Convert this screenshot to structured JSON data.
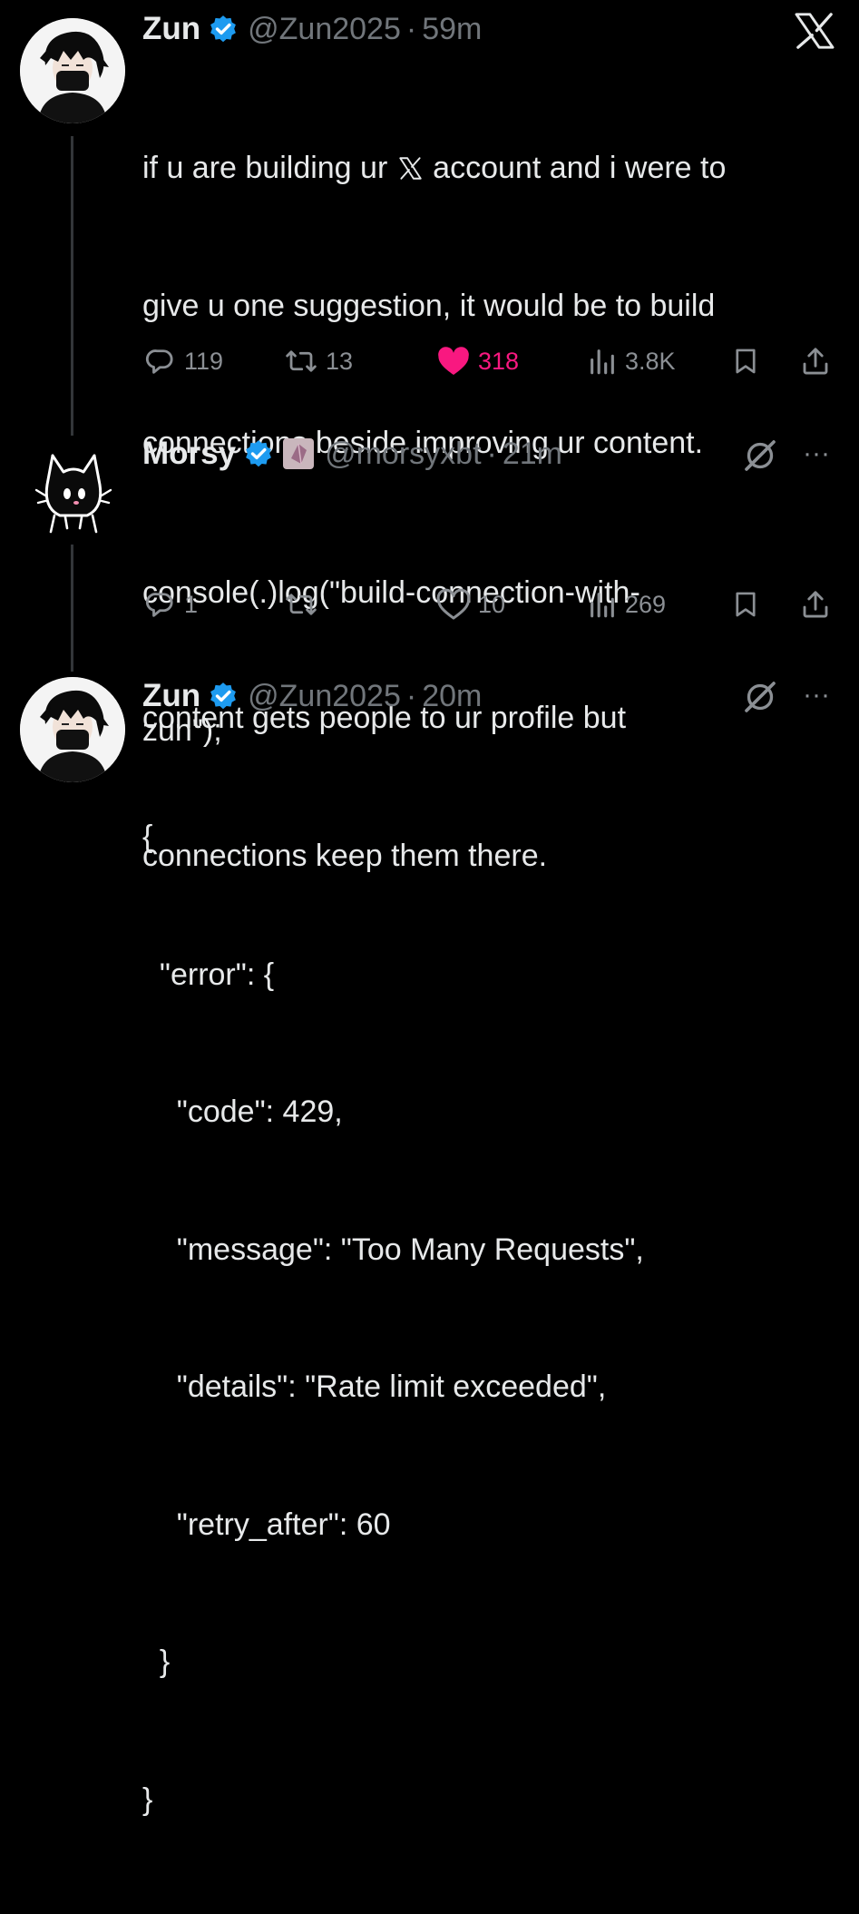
{
  "colors": {
    "background": "#000000",
    "text": "#e7e9ea",
    "muted": "#71767b",
    "like": "#f91880",
    "verified": "#1d9bf0"
  },
  "app_logo": "x-logo-icon",
  "tweets": [
    {
      "name": "Zun",
      "handle": "@Zun2025",
      "separator": "·",
      "time": "59m",
      "text_lines": [
        "if u are building ur ",
        " account and i were to",
        "give u one suggestion, it would be to build",
        "connections beside improving ur content.",
        "",
        "content gets people to ur profile but",
        "connections keep them there."
      ],
      "stats": {
        "replies": "119",
        "reposts": "13",
        "likes": "318",
        "views": "3.8K"
      },
      "liked": true
    },
    {
      "name": "Morsy",
      "handle": "@morsyxbt",
      "separator": "·",
      "time": "21m",
      "text_lines": [
        "console(.)log(\"build-connection-with-",
        "zun\");"
      ],
      "stats": {
        "replies": "1",
        "reposts": "",
        "likes": "10",
        "views": "269"
      },
      "liked": false
    },
    {
      "name": "Zun",
      "handle": "@Zun2025",
      "separator": "·",
      "time": "20m",
      "text_lines": [
        "{",
        "  \"error\": {",
        "    \"code\": 429,",
        "    \"message\": \"Too Many Requests\",",
        "    \"details\": \"Rate limit exceeded\",",
        "    \"retry_after\": 60",
        "  }",
        "}"
      ]
    }
  ],
  "more_label": "···"
}
